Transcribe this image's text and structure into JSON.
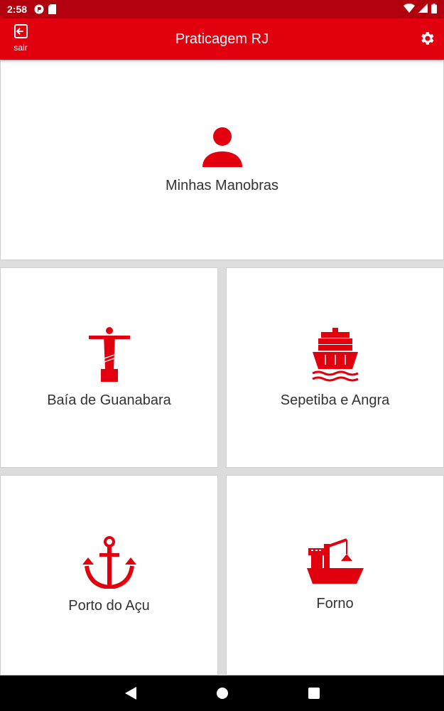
{
  "status_bar": {
    "time": "2:58"
  },
  "app_bar": {
    "title": "Praticagem RJ",
    "exit_label": "sair"
  },
  "tiles": {
    "main": {
      "label": "Minhas Manobras",
      "icon": "person-icon"
    },
    "guanabara": {
      "label": "Baía de Guanabara",
      "icon": "christ-redeemer-icon"
    },
    "sepetiba": {
      "label": "Sepetiba e Angra",
      "icon": "container-ship-icon"
    },
    "acu": {
      "label": "Porto do Açu",
      "icon": "anchor-icon"
    },
    "forno": {
      "label": "Forno",
      "icon": "crane-ship-icon"
    }
  },
  "colors": {
    "accent": "#e2000f",
    "status_bar": "#b3000f",
    "tile_bg": "#ffffff",
    "gutter": "#dcdcdc"
  }
}
